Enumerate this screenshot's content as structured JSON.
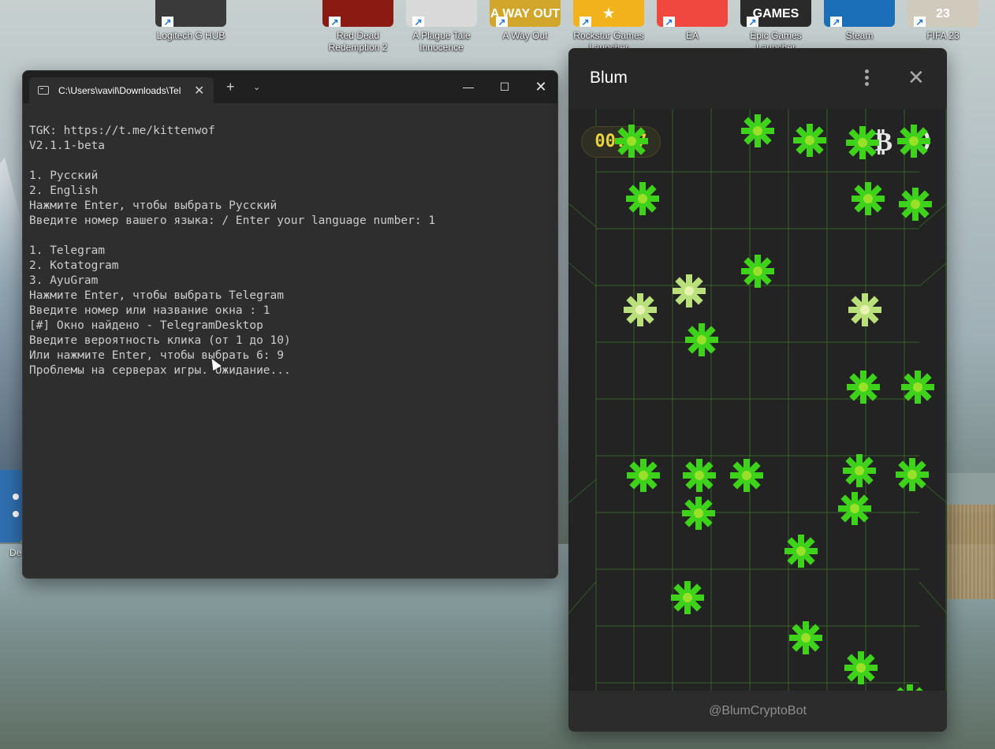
{
  "desktop": {
    "icons": [
      {
        "label": "Logitech G HUB",
        "tile": "",
        "color": "#3a3a3a"
      },
      {
        "label": "Red Dead Redemption 2",
        "tile": "",
        "color": "#8b1a12"
      },
      {
        "label": "A Plague Tale Innocence",
        "tile": "",
        "color": "#d9d9d9"
      },
      {
        "label": "A Way Out",
        "tile": "A WAY OUT",
        "color": "#d1a62a"
      },
      {
        "label": "Rockstar Games Launcher",
        "tile": "★",
        "color": "#f2b21b"
      },
      {
        "label": "EA",
        "tile": "",
        "color": "#f0483e"
      },
      {
        "label": "Epic Games Launcher",
        "tile": "GAMES",
        "color": "#2a2a2a"
      },
      {
        "label": "Steam",
        "tile": "",
        "color": "#1b6fb8"
      },
      {
        "label": "FIFA 23",
        "tile": "23",
        "color": "#cfcabb"
      }
    ],
    "left_icon_label": "De"
  },
  "terminal": {
    "tab_title": "C:\\Users\\vavil\\Downloads\\Tel",
    "lines": [
      "TGK: https://t.me/kittenwof",
      "V2.1.1-beta",
      "",
      "1. Русский",
      "2. English",
      "Нажмите Enter, чтобы выбрать Русский",
      "Введите номер вашего языка: / Enter your language number: 1",
      "",
      "1. Telegram",
      "2. Kotatogram",
      "3. AyuGram",
      "Нажмите Enter, чтобы выбрать Telegram",
      "Введите номер или название окна : 1",
      "[#] Окно найдено - TelegramDesktop",
      "Введите вероятность клика (от 1 до 10)",
      "Или нажмите Enter, чтобы выбрать 6: 9",
      "Проблемы на серверах игры. Ожидание..."
    ]
  },
  "blum": {
    "title": "Blum",
    "timer": "00:27",
    "score": "₿ 0",
    "footer": "@BlumCryptoBot",
    "colors": {
      "flower": "#3ed21b",
      "flower_pale": "#b9e07a",
      "grid": "#3f7a2a"
    }
  }
}
